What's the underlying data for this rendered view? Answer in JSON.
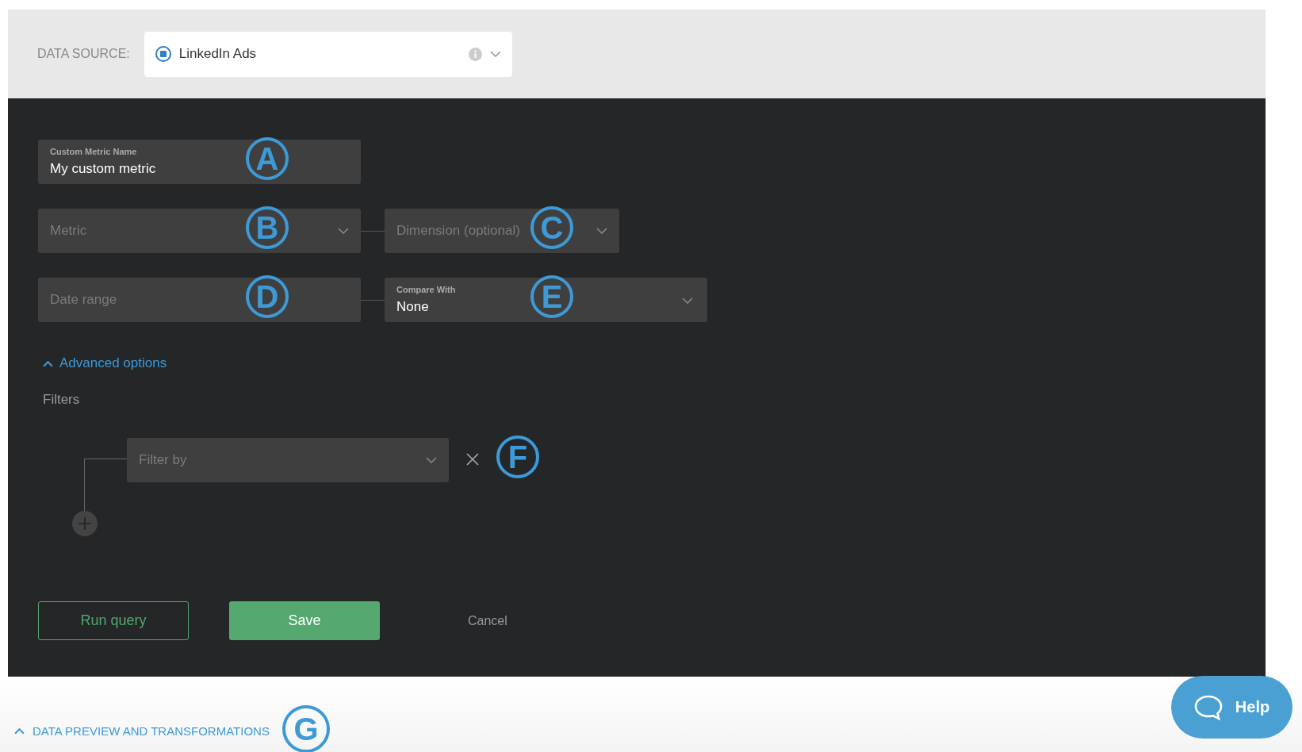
{
  "data_source": {
    "label": "DATA SOURCE:",
    "value": "LinkedIn Ads"
  },
  "name_field": {
    "label": "Custom Metric Name",
    "value": "My custom metric",
    "marker": "A"
  },
  "metric_row": [
    {
      "placeholder": "Metric",
      "marker": "B"
    },
    {
      "placeholder": "Dimension (optional)",
      "marker": "C"
    }
  ],
  "date_row": [
    {
      "placeholder": "Date range",
      "marker": "D"
    },
    {
      "label": "Compare With",
      "value": "None",
      "marker": "E"
    }
  ],
  "advanced": {
    "label": "Advanced options",
    "expanded": true
  },
  "filters": {
    "label": "Filters",
    "placeholder": "Filter by",
    "marker": "F"
  },
  "buttons": {
    "run": "Run query",
    "save": "Save",
    "cancel": "Cancel"
  },
  "preview": {
    "label": "DATA PREVIEW AND TRANSFORMATIONS",
    "expanded": true,
    "marker": "G"
  },
  "help": "Help"
}
